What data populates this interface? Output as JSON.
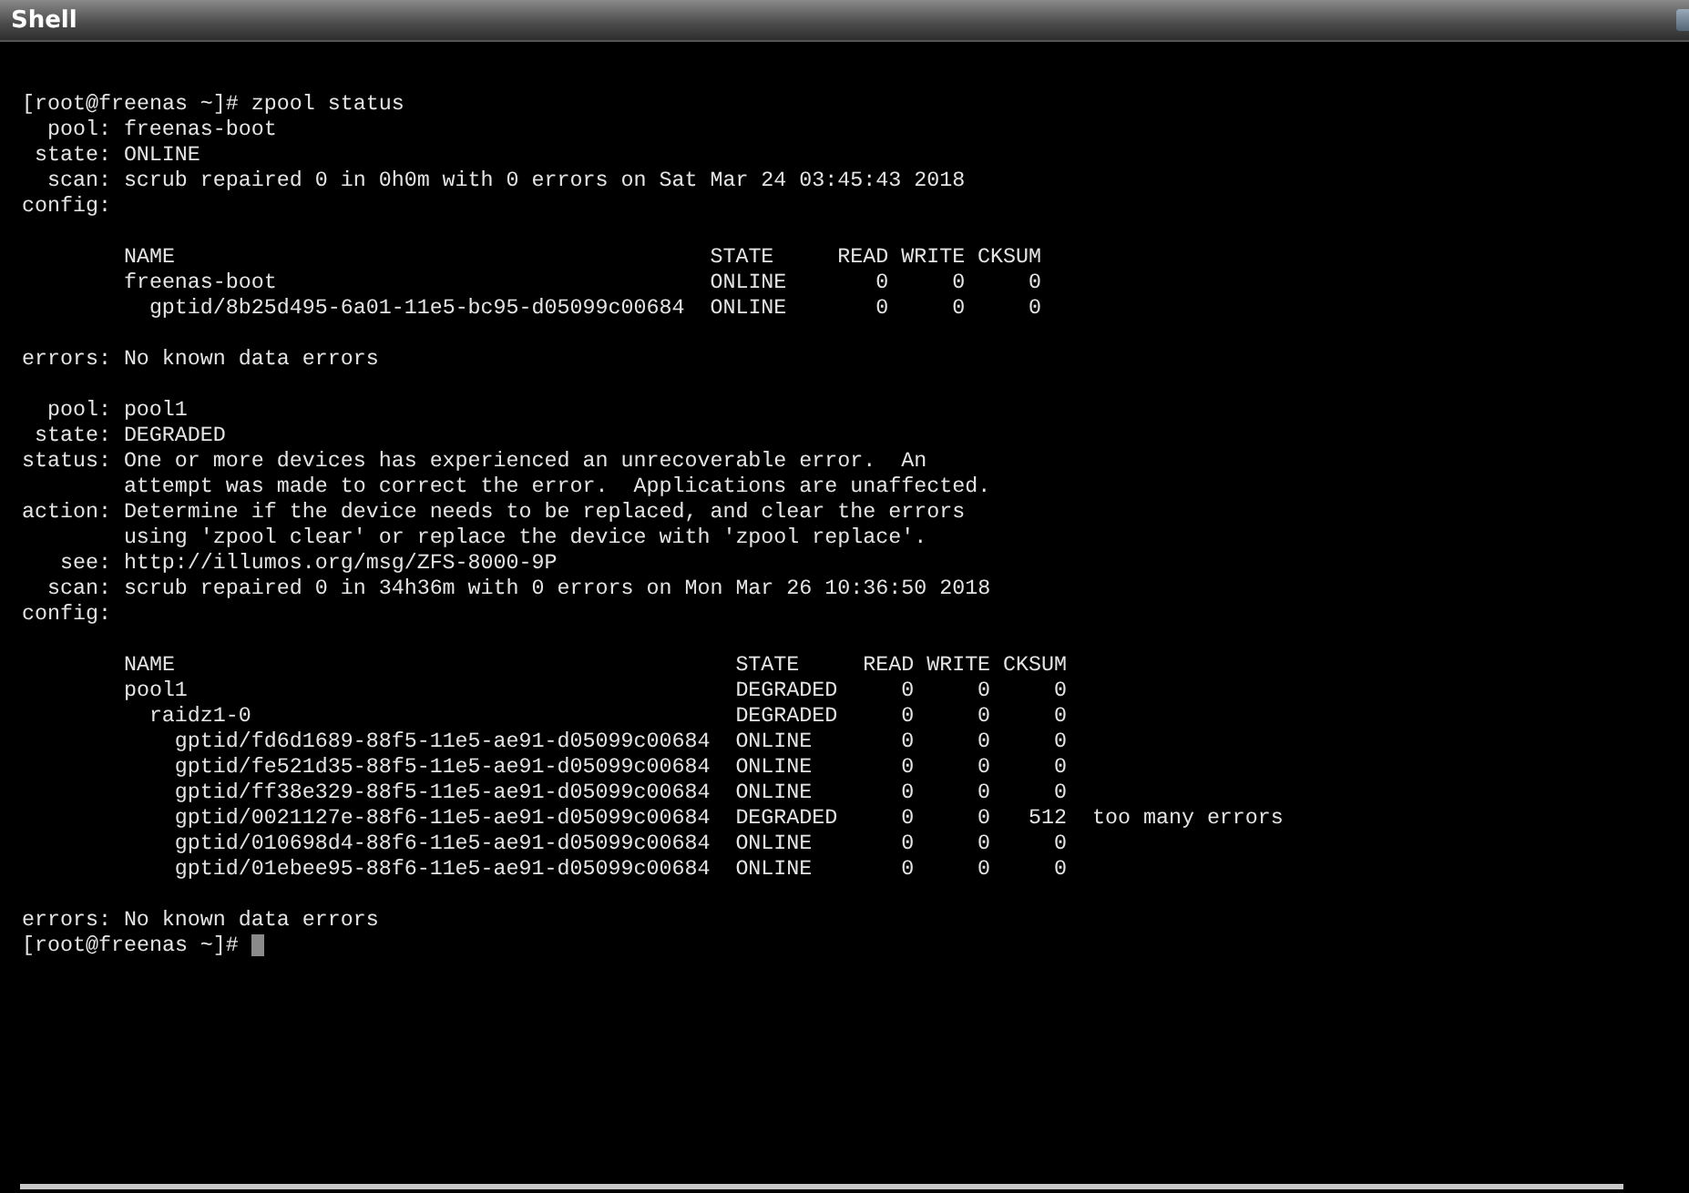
{
  "window": {
    "title": "Shell"
  },
  "terminal": {
    "command": {
      "prompt": "[root@freenas ~]#",
      "text": "zpool status"
    },
    "pools": [
      {
        "fields": [
          {
            "label": "pool:",
            "lines": [
              "freenas-boot"
            ]
          },
          {
            "label": "state:",
            "lines": [
              "ONLINE"
            ]
          },
          {
            "label": "scan:",
            "lines": [
              "scrub repaired 0 in 0h0m with 0 errors on Sat Mar 24 03:45:43 2018"
            ]
          },
          {
            "label": "config:"
          }
        ],
        "columns": [
          "NAME",
          "STATE",
          "READ",
          "WRITE",
          "CKSUM"
        ],
        "vdevs": [
          {
            "name": "freenas-boot",
            "state": "ONLINE",
            "read": "0",
            "write": "0",
            "cksum": "0",
            "children": [
              {
                "name": "gptid/8b25d495-6a01-11e5-bc95-d05099c00684",
                "state": "ONLINE",
                "read": "0",
                "write": "0",
                "cksum": "0"
              }
            ]
          }
        ],
        "after_fields": [
          {
            "label": "errors:",
            "lines": [
              "No known data errors"
            ]
          }
        ]
      },
      {
        "fields": [
          {
            "label": "pool:",
            "lines": [
              "pool1"
            ]
          },
          {
            "label": "state:",
            "lines": [
              "DEGRADED"
            ]
          },
          {
            "label": "status:",
            "lines": [
              "One or more devices has experienced an unrecoverable error.  An",
              "attempt was made to correct the error.  Applications are unaffected."
            ]
          },
          {
            "label": "action:",
            "lines": [
              "Determine if the device needs to be replaced, and clear the errors",
              "using 'zpool clear' or replace the device with 'zpool replace'."
            ]
          },
          {
            "label": "see:",
            "lines": [
              "http://illumos.org/msg/ZFS-8000-9P"
            ]
          },
          {
            "label": "scan:",
            "lines": [
              "scrub repaired 0 in 34h36m with 0 errors on Mon Mar 26 10:36:50 2018"
            ]
          },
          {
            "label": "config:"
          }
        ],
        "columns": [
          "NAME",
          "STATE",
          "READ",
          "WRITE",
          "CKSUM"
        ],
        "vdevs": [
          {
            "name": "pool1",
            "state": "DEGRADED",
            "read": "0",
            "write": "0",
            "cksum": "0",
            "children": [
              {
                "name": "raidz1-0",
                "state": "DEGRADED",
                "read": "0",
                "write": "0",
                "cksum": "0",
                "children": [
                  {
                    "name": "gptid/fd6d1689-88f5-11e5-ae91-d05099c00684",
                    "state": "ONLINE",
                    "read": "0",
                    "write": "0",
                    "cksum": "0"
                  },
                  {
                    "name": "gptid/fe521d35-88f5-11e5-ae91-d05099c00684",
                    "state": "ONLINE",
                    "read": "0",
                    "write": "0",
                    "cksum": "0"
                  },
                  {
                    "name": "gptid/ff38e329-88f5-11e5-ae91-d05099c00684",
                    "state": "ONLINE",
                    "read": "0",
                    "write": "0",
                    "cksum": "0"
                  },
                  {
                    "name": "gptid/0021127e-88f6-11e5-ae91-d05099c00684",
                    "state": "DEGRADED",
                    "read": "0",
                    "write": "0",
                    "cksum": "512",
                    "note": "too many errors"
                  },
                  {
                    "name": "gptid/010698d4-88f6-11e5-ae91-d05099c00684",
                    "state": "ONLINE",
                    "read": "0",
                    "write": "0",
                    "cksum": "0"
                  },
                  {
                    "name": "gptid/01ebee95-88f6-11e5-ae91-d05099c00684",
                    "state": "ONLINE",
                    "read": "0",
                    "write": "0",
                    "cksum": "0"
                  }
                ]
              }
            ]
          }
        ],
        "after_fields": [
          {
            "label": "errors:",
            "lines": [
              "No known data errors"
            ]
          }
        ]
      }
    ],
    "prompt": "[root@freenas ~]#"
  }
}
